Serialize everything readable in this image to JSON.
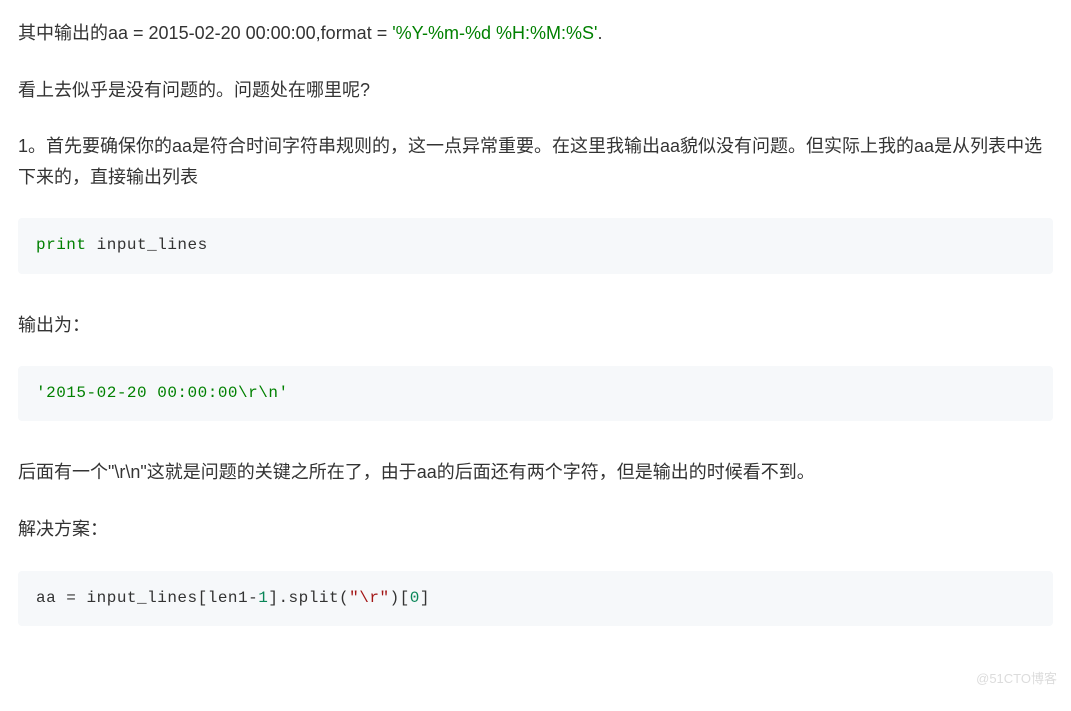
{
  "para1_prefix": "其中输出的aa = 2015-02-20 00:00:00,format = ",
  "para1_format": "'%Y-%m-%d  %H:%M:%S'",
  "para1_suffix": ".",
  "para2": "看上去似乎是没有问题的。问题处在哪里呢?",
  "para3": "1。首先要确保你的aa是符合时间字符串规则的，这一点异常重要。在这里我输出aa貌似没有问题。但实际上我的aa是从列表中选下来的，直接输出列表",
  "code1_kw": "print",
  "code1_rest": " input_lines",
  "para4": "输出为：",
  "code2": "'2015-02-20 00:00:00\\r\\n'",
  "para5": "后面有一个\"\\r\\n\"这就是问题的关键之所在了，由于aa的后面还有两个字符，但是输出的时候看不到。",
  "para6": "解决方案：",
  "code3_a": "aa = input_lines[len1-",
  "code3_num": "1",
  "code3_b": "].split(",
  "code3_str": "\"\\r\"",
  "code3_c": ")[",
  "code3_num2": "0",
  "code3_d": "]",
  "watermark": "@51CTO博客"
}
